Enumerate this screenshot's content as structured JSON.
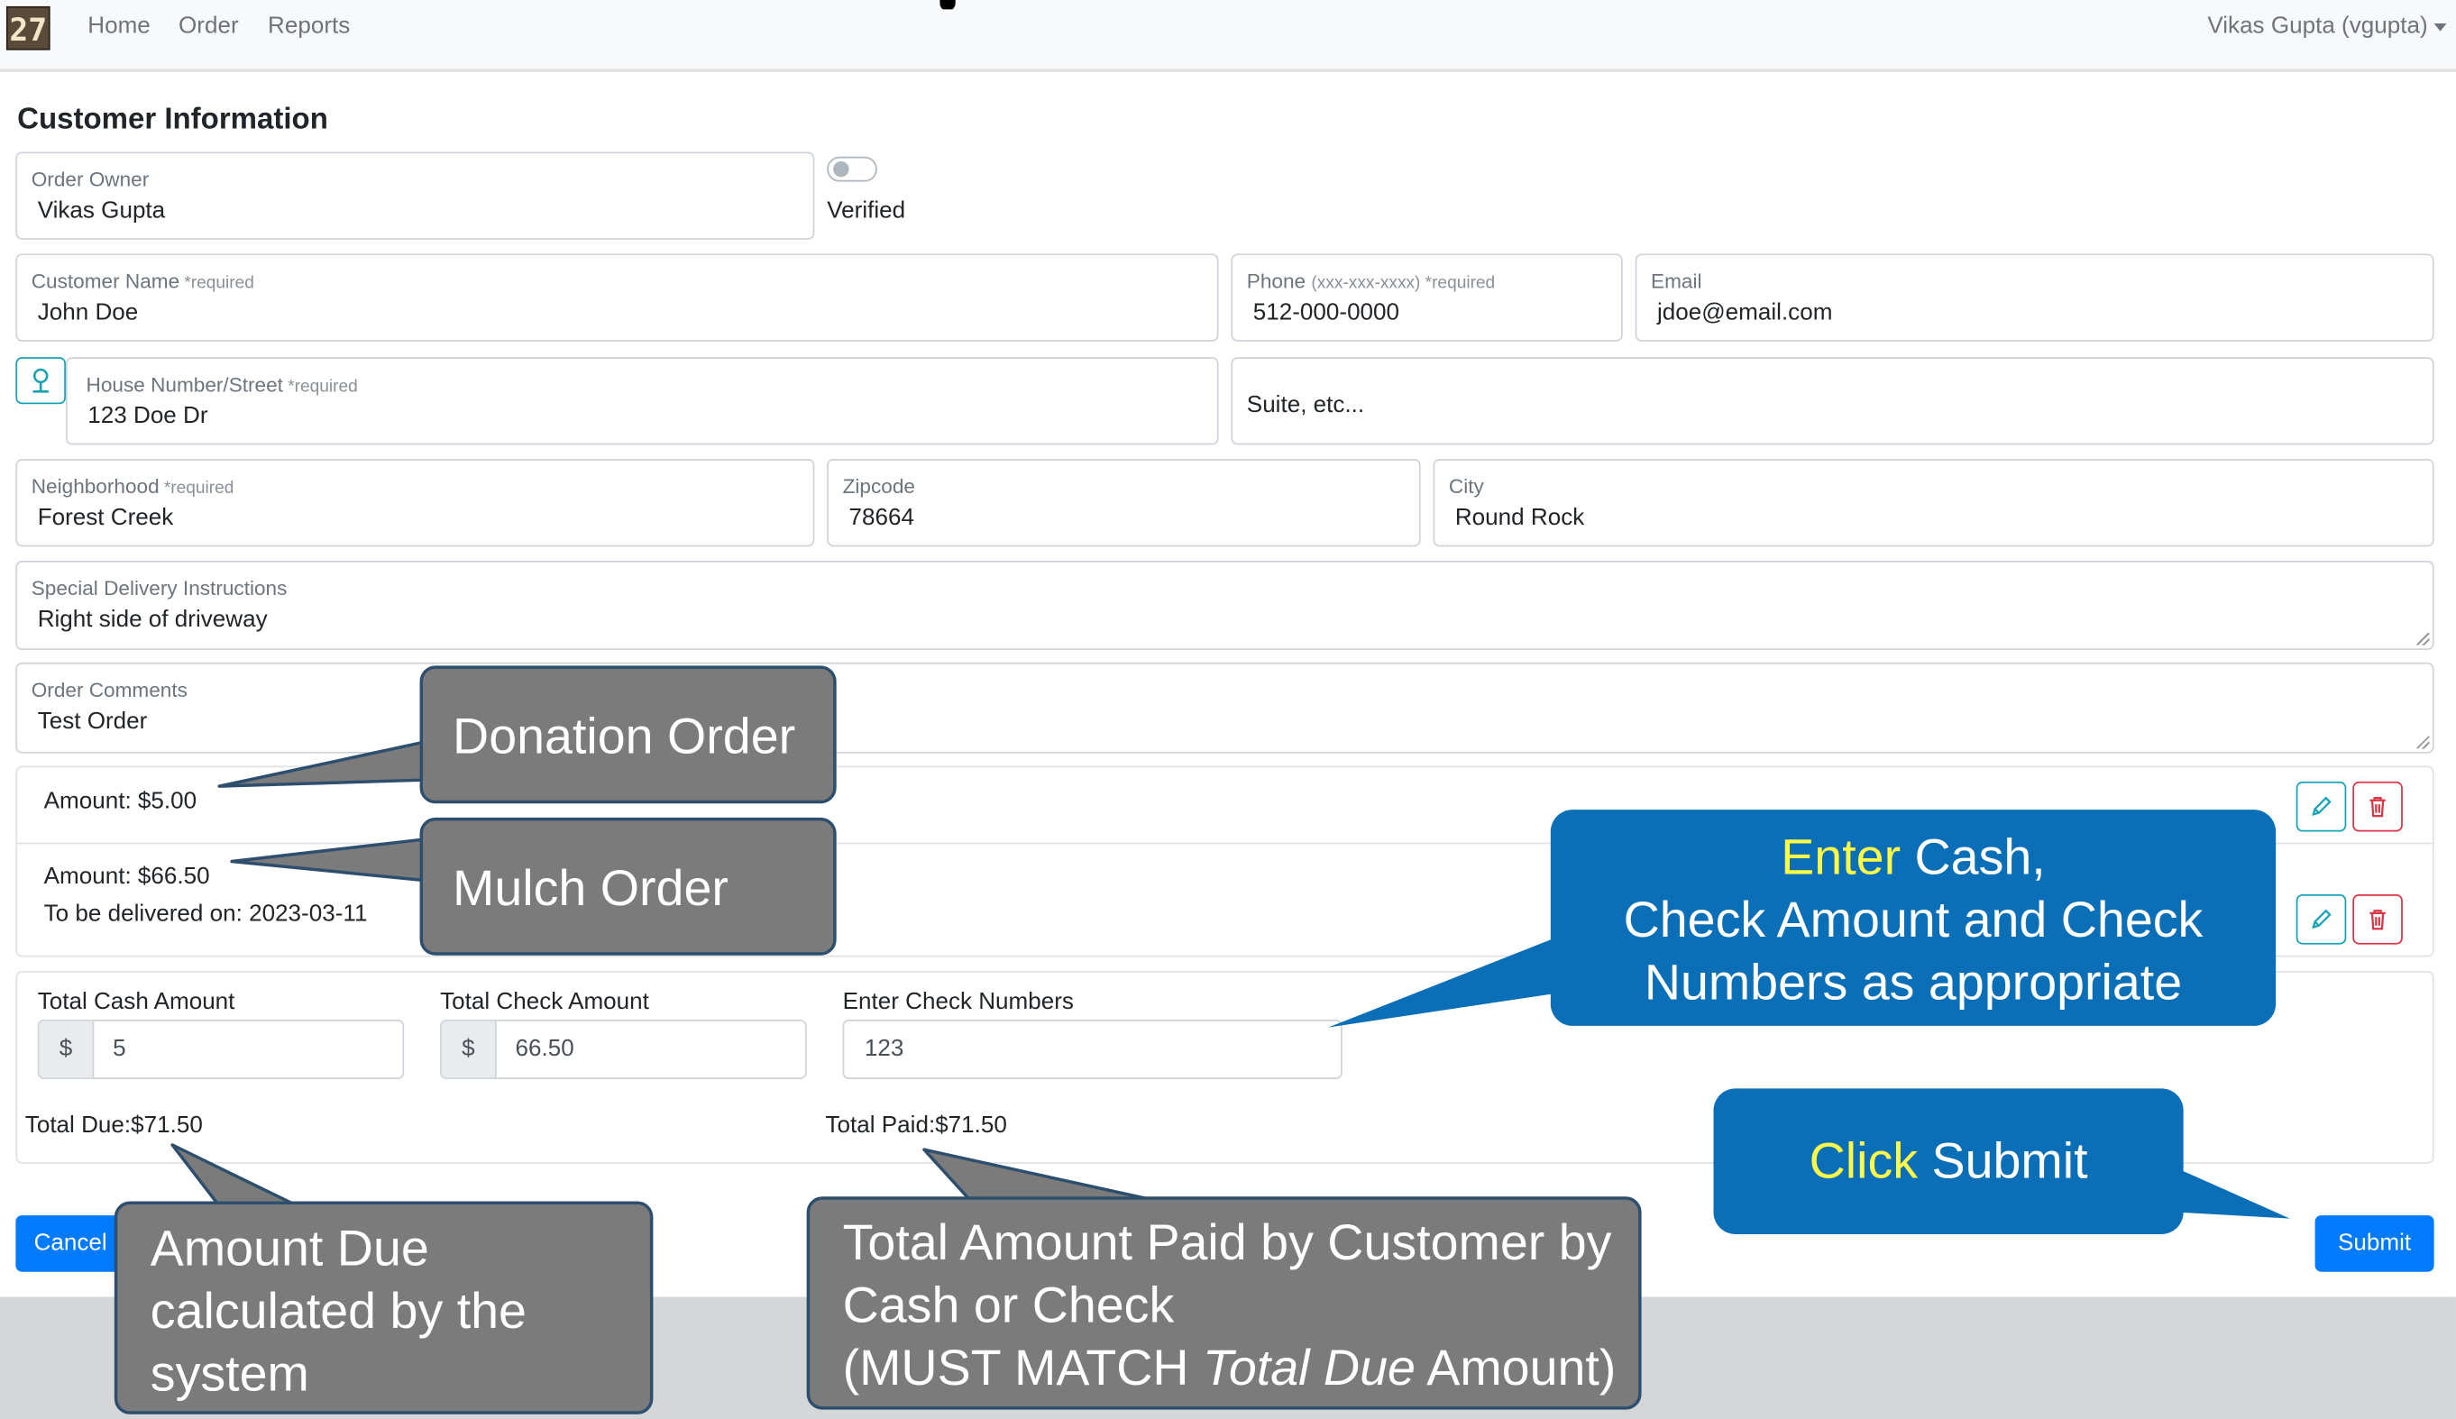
{
  "navbar": {
    "logo_text": "27",
    "links": [
      "Home",
      "Order",
      "Reports"
    ],
    "user": "Vikas Gupta (vgupta)"
  },
  "form": {
    "section_title": "Customer Information",
    "order_owner": {
      "label": "Order Owner",
      "value": "Vikas Gupta"
    },
    "verified": {
      "label": "Verified",
      "checked": false
    },
    "customer_name": {
      "label": "Customer Name",
      "required": "*required",
      "value": "John Doe"
    },
    "phone": {
      "label": "Phone",
      "hint": "(xxx-xxx-xxxx)",
      "required": "*required",
      "value": "512-000-0000"
    },
    "email": {
      "label": "Email",
      "value": "jdoe@email.com"
    },
    "street": {
      "label": "House Number/Street",
      "required": "*required",
      "value": "123 Doe Dr"
    },
    "suite": {
      "placeholder": "Suite, etc..."
    },
    "neighborhood": {
      "label": "Neighborhood",
      "required": "*required",
      "value": "Forest Creek"
    },
    "zipcode": {
      "label": "Zipcode",
      "value": "78664"
    },
    "city": {
      "label": "City",
      "value": "Round Rock"
    },
    "delivery_instructions": {
      "label": "Special Delivery Instructions",
      "value": "Right side of driveway"
    },
    "order_comments": {
      "label": "Order Comments",
      "value": "Test Order"
    }
  },
  "orders": [
    {
      "amount": "Amount: $5.00"
    },
    {
      "amount": "Amount: $66.50",
      "delivery": "To be delivered on: 2023-03-11"
    }
  ],
  "payment": {
    "cash_label": "Total Cash Amount",
    "cash_prefix": "$",
    "cash_value": "5",
    "check_label": "Total Check Amount",
    "check_prefix": "$",
    "check_value": "66.50",
    "check_numbers_label": "Enter Check Numbers",
    "check_numbers_value": "123",
    "total_due": "Total Due:$71.50",
    "total_paid": "Total Paid:$71.50"
  },
  "buttons": {
    "cancel": "Cancel",
    "submit": "Submit"
  },
  "callouts": {
    "donation": "Donation  Order",
    "mulch": "Mulch Order",
    "enter_hl": "Enter",
    "enter_rest1": " Cash,",
    "enter_line2": "Check Amount and Check",
    "enter_line3": "Numbers as appropriate",
    "click_hl": "Click",
    "click_rest": " Submit",
    "due_line1": "Amount Due",
    "due_line2": "calculated by the",
    "due_line3": "system",
    "paid_line1": "Total Amount Paid by Customer by",
    "paid_line2": "Cash or Check",
    "paid_line3_a": "(MUST MATCH ",
    "paid_line3_b": "Total Due",
    "paid_line3_c": " Amount)"
  },
  "colors": {
    "primary": "#007bff",
    "info": "#17a2b8",
    "danger": "#dc3545",
    "callout_blue": "#0b6fb8",
    "callout_gray": "#7b7b7b",
    "highlight": "#fff94a"
  },
  "icons": [
    "map-pin-icon",
    "pencil-icon",
    "trash-icon",
    "chevron-down-icon"
  ]
}
